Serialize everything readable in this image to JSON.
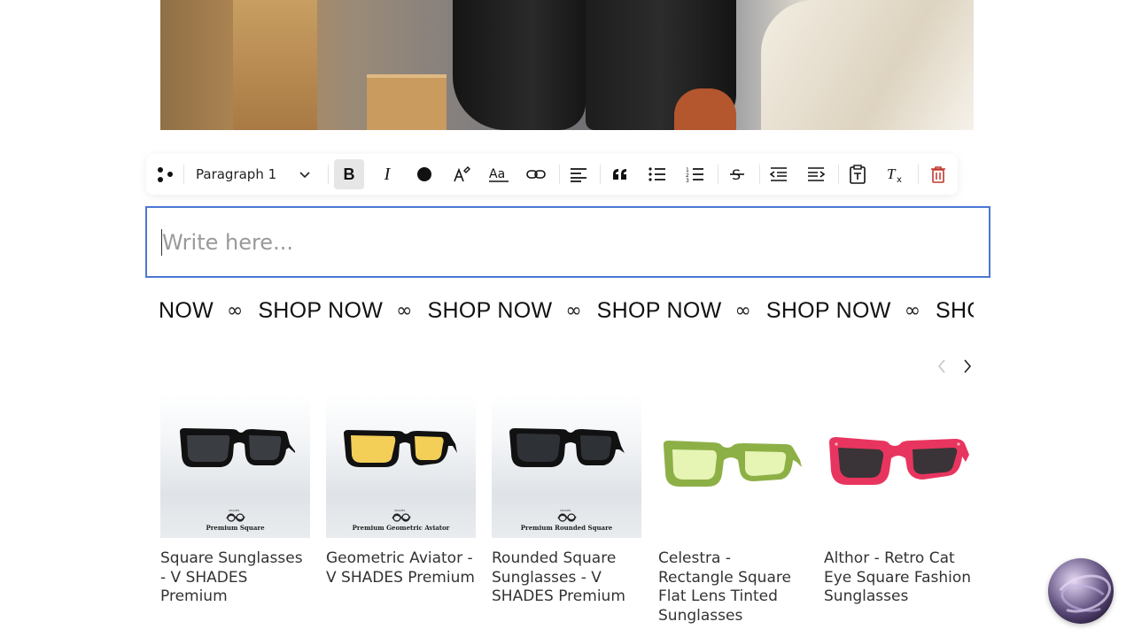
{
  "toolbar": {
    "paragraph_style": "Paragraph 1",
    "icons": [
      "drag-handle-icon",
      "bold-icon",
      "italic-icon",
      "text-color-icon",
      "highlight-icon",
      "font-size-icon",
      "link-icon",
      "align-left-icon",
      "quote-icon",
      "bullet-list-icon",
      "numbered-list-icon",
      "strikethrough-icon",
      "outdent-icon",
      "indent-icon",
      "paste-text-icon",
      "clear-format-icon",
      "delete-icon"
    ]
  },
  "editor": {
    "placeholder": "Write here..."
  },
  "marquee": {
    "items": [
      "NOW",
      "SHOP NOW",
      "SHOP NOW",
      "SHOP NOW",
      "SHOP NOW",
      "SHOP"
    ],
    "symbol": "∞"
  },
  "products": [
    {
      "title": "Square Sunglasses - V SHADES Premium",
      "badge": "Premium Square",
      "lens_color": "#3a3d42",
      "frame_color": "#111111",
      "style": "studio"
    },
    {
      "title": "Geometric Aviator - V SHADES Premium",
      "badge": "Premium Geometric Aviator",
      "lens_color": "#f3cf58",
      "frame_color": "#111111",
      "style": "studio"
    },
    {
      "title": "Rounded Square Sunglasses - V SHADES Premium",
      "badge": "Premium Rounded Square",
      "lens_color": "#2e3136",
      "frame_color": "#111111",
      "style": "studio"
    },
    {
      "title": "Celestra - Rectangle Square Flat Lens Tinted Sunglasses",
      "badge": "",
      "lens_color": "#e6f4b4",
      "frame_color": "#8db046",
      "style": "plain"
    },
    {
      "title": "Althor - Retro Cat Eye Square Fashion Sunglasses",
      "badge": "",
      "lens_color": "#3a3438",
      "frame_color": "#e8355f",
      "style": "plain"
    }
  ],
  "colors": {
    "editor_border": "#4a77d4",
    "delete_icon": "#c0392b"
  }
}
